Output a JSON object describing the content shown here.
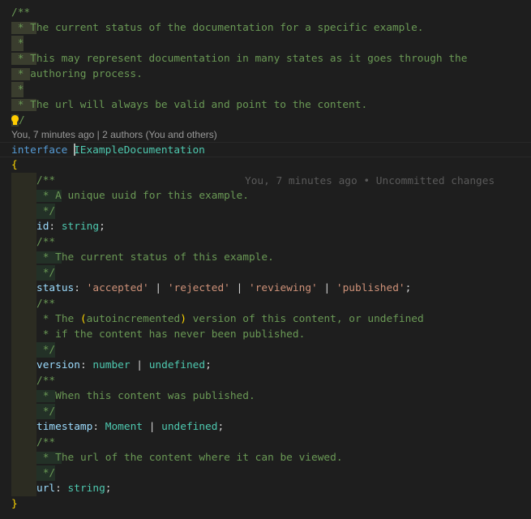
{
  "editor": {
    "doc_comment": {
      "open": "/**",
      "lines": [
        " * The current status of the documentation for a specific example.",
        " *",
        " * This may represent documentation in many states as it goes through the",
        " * authoring process.",
        " *",
        " * The url will always be valid and point to the content."
      ],
      "close": "/"
    },
    "codelens": "You, 7 minutes ago | 2 authors (You and others)",
    "interface_keyword": "interface",
    "interface_name": "IExampleDocumentation",
    "blame_annotation": "You, 7 minutes ago • Uncommitted changes",
    "open_brace": "{",
    "close_brace": "}",
    "members": [
      {
        "comment": [
          "/**",
          " * A unique uuid for this example.",
          " */"
        ],
        "name": "id",
        "type_parts": [
          "string"
        ]
      },
      {
        "comment": [
          "/**",
          " * The current status of this example.",
          " */"
        ],
        "name": "status",
        "literals": [
          "'accepted'",
          "'rejected'",
          "'reviewing'",
          "'published'"
        ]
      },
      {
        "comment_open": "/**",
        "comment_line1_pre": " * The ",
        "comment_line1_paren_open": "(",
        "comment_line1_mid": "autoincremented",
        "comment_line1_paren_close": ")",
        "comment_line1_post": " version of this content, or undefined",
        "comment_line2": " * if the content has never been published.",
        "comment_close": " */",
        "name": "version",
        "type_parts": [
          "number",
          "undefined"
        ]
      },
      {
        "comment": [
          "/**",
          " * When this content was published.",
          " */"
        ],
        "name": "timestamp",
        "type_parts": [
          "Moment",
          "undefined"
        ]
      },
      {
        "comment": [
          "/**",
          " * The url of the content where it can be viewed.",
          " */"
        ],
        "name": "url",
        "type_parts": [
          "string"
        ]
      }
    ],
    "colon": ": ",
    "pipe": " | ",
    "semicolon": ";",
    "lightbulb_icon": "lightbulb-icon"
  }
}
